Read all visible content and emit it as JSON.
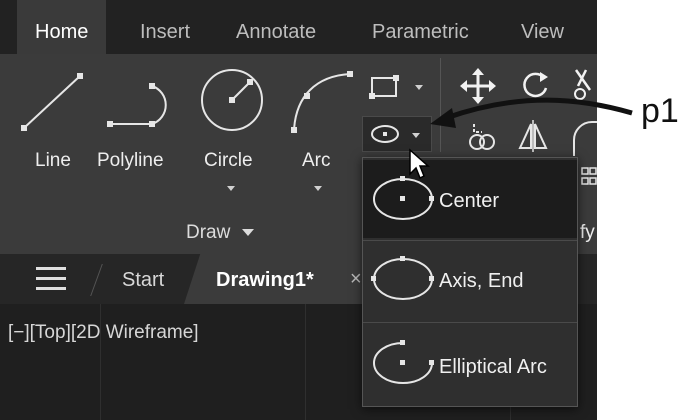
{
  "ribbon": {
    "tabs": [
      "Home",
      "Insert",
      "Annotate",
      "Parametric",
      "View"
    ],
    "active_tab": "Home",
    "draw_tools": {
      "line": "Line",
      "polyline": "Polyline",
      "circle": "Circle",
      "arc": "Arc"
    },
    "draw_panel_label": "Draw",
    "modify_panel_label_partial": "fy"
  },
  "file_tabs": {
    "start": "Start",
    "drawing": "Drawing1*",
    "close_glyph": "×"
  },
  "viewport": {
    "label": "[−][Top][2D Wireframe]"
  },
  "ellipse_dropdown": {
    "items": [
      {
        "label": "Center",
        "icon": "ellipse-center-icon",
        "highlighted": true
      },
      {
        "label": "Axis, End",
        "icon": "ellipse-axis-end-icon",
        "highlighted": false
      },
      {
        "label": "Elliptical Arc",
        "icon": "elliptical-arc-icon",
        "highlighted": false
      }
    ]
  },
  "callout": {
    "label": "p1"
  },
  "colors": {
    "ribbon_bg": "#3b3b3b",
    "tabbar_bg": "#222222",
    "viewport_bg": "#1f1f1f",
    "highlight_bg": "#1c1c1c",
    "icon_stroke": "#e6e6e6"
  }
}
